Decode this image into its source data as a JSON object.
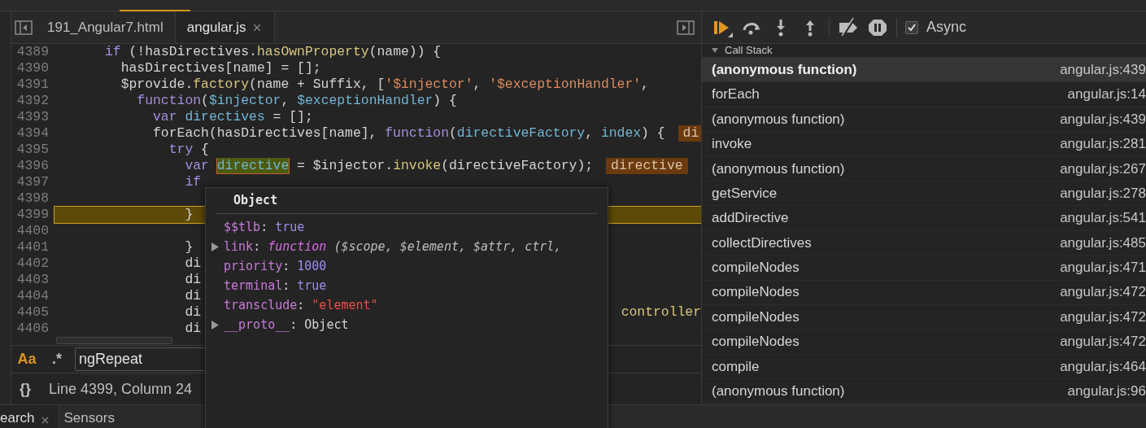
{
  "editor_tabs": [
    {
      "label": "191_Angular7.html",
      "selected": false,
      "closable": false
    },
    {
      "label": "angular.js",
      "selected": true,
      "closable": true
    }
  ],
  "code_lines": [
    {
      "number": "4389",
      "current": false,
      "tokens": [
        {
          "kind": "k",
          "text": "      if"
        },
        {
          "kind": "p",
          "text": " (!hasDirectives."
        },
        {
          "kind": "m",
          "text": "hasOwnProperty"
        },
        {
          "kind": "p",
          "text": "(name)) {"
        }
      ]
    },
    {
      "number": "4390",
      "current": false,
      "tokens": [
        {
          "kind": "p",
          "text": "        hasDirectives[name] = [];"
        }
      ]
    },
    {
      "number": "4391",
      "current": false,
      "tokens": [
        {
          "kind": "p",
          "text": "        $provide."
        },
        {
          "kind": "m",
          "text": "factory"
        },
        {
          "kind": "p",
          "text": "(name + Suffix, ["
        },
        {
          "kind": "s",
          "text": "'$injector'"
        },
        {
          "kind": "p",
          "text": ", "
        },
        {
          "kind": "s",
          "text": "'$exceptionHandler'"
        },
        {
          "kind": "p",
          "text": ","
        }
      ]
    },
    {
      "number": "4392",
      "current": false,
      "tokens": [
        {
          "kind": "k",
          "text": "          function"
        },
        {
          "kind": "p",
          "text": "("
        },
        {
          "kind": "v",
          "text": "$injector"
        },
        {
          "kind": "p",
          "text": ", "
        },
        {
          "kind": "v",
          "text": "$exceptionHandler"
        },
        {
          "kind": "p",
          "text": ") {"
        }
      ]
    },
    {
      "number": "4393",
      "current": false,
      "tokens": [
        {
          "kind": "k",
          "text": "            var "
        },
        {
          "kind": "v",
          "text": "directives"
        },
        {
          "kind": "p",
          "text": " = [];"
        }
      ]
    },
    {
      "number": "4394",
      "current": false,
      "tokens": [
        {
          "kind": "p",
          "text": "            forEach(hasDirectives[name], "
        },
        {
          "kind": "k",
          "text": "function"
        },
        {
          "kind": "p",
          "text": "("
        },
        {
          "kind": "v",
          "text": "directiveFactory"
        },
        {
          "kind": "p",
          "text": ", "
        },
        {
          "kind": "v",
          "text": "index"
        },
        {
          "kind": "p",
          "text": ") {"
        }
      ],
      "inline_value": "di"
    },
    {
      "number": "4395",
      "current": false,
      "tokens": [
        {
          "kind": "k",
          "text": "              try"
        },
        {
          "kind": "p",
          "text": " {"
        }
      ]
    },
    {
      "number": "4396",
      "current": false,
      "tokens": [
        {
          "kind": "k",
          "text": "                var "
        },
        {
          "kind": "h",
          "text": "directive"
        },
        {
          "kind": "p",
          "text": " = $injector."
        },
        {
          "kind": "m",
          "text": "invoke"
        },
        {
          "kind": "p",
          "text": "(directiveFactory);"
        }
      ],
      "inline_value": "directive"
    },
    {
      "number": "4397",
      "current": false,
      "tokens": [
        {
          "kind": "k",
          "text": "                if"
        }
      ]
    },
    {
      "number": "4398",
      "current": false
    },
    {
      "number": "4399",
      "current": true,
      "tokens": [
        {
          "kind": "p",
          "text": "                }"
        }
      ]
    },
    {
      "number": "4400",
      "current": false
    },
    {
      "number": "4401",
      "current": false,
      "tokens": [
        {
          "kind": "p",
          "text": "                }"
        }
      ]
    },
    {
      "number": "4402",
      "current": false,
      "tokens": [
        {
          "kind": "p",
          "text": "                di"
        }
      ]
    },
    {
      "number": "4403",
      "current": false,
      "tokens": [
        {
          "kind": "p",
          "text": "                di"
        }
      ]
    },
    {
      "number": "4404",
      "current": false,
      "tokens": [
        {
          "kind": "p",
          "text": "                di"
        }
      ]
    },
    {
      "number": "4405",
      "current": false,
      "tokens": [
        {
          "kind": "p",
          "text": "                di"
        }
      ],
      "tail": "controller"
    },
    {
      "number": "4406",
      "current": false,
      "tokens": [
        {
          "kind": "p",
          "text": "                di"
        }
      ]
    }
  ],
  "object_popover": {
    "title": "Object",
    "properties": [
      {
        "key": "$$tlb",
        "separator": ":",
        "expandable": false,
        "kind": "literal",
        "value": "true"
      },
      {
        "key": "link",
        "separator": ":",
        "expandable": true,
        "kind": "function",
        "value": "function ($scope, $element, $attr, ctrl,"
      },
      {
        "key": "priority",
        "separator": ":",
        "expandable": false,
        "kind": "literal",
        "value": "1000"
      },
      {
        "key": "terminal",
        "separator": ":",
        "expandable": false,
        "kind": "literal",
        "value": "true"
      },
      {
        "key": "transclude",
        "separator": ":",
        "expandable": false,
        "kind": "string",
        "value": "\"element\""
      },
      {
        "key": "__proto__",
        "separator": ":",
        "expandable": true,
        "kind": "object",
        "value": "Object"
      }
    ]
  },
  "search_bar": {
    "match_case": {
      "label": "Aa",
      "on": true
    },
    "regex": {
      "label": ".*",
      "on": false
    },
    "query": "ngRepeat"
  },
  "status_bar": {
    "format_button": "{}",
    "position": "Line 4399, Column 24"
  },
  "bottom_tabs": [
    {
      "label": "earch",
      "selected": true,
      "closable": true
    },
    {
      "label": "Sensors",
      "selected": false,
      "closable": false
    }
  ],
  "debugger_toolbar": {
    "async": {
      "label": "Async",
      "checked": true
    }
  },
  "call_stack": {
    "title": "Call Stack",
    "expanded": true,
    "frames": [
      {
        "name": "(anonymous function)",
        "location": "angular.js:439",
        "selected": true
      },
      {
        "name": "forEach",
        "location": "angular.js:14",
        "selected": false
      },
      {
        "name": "(anonymous function)",
        "location": "angular.js:439",
        "selected": false
      },
      {
        "name": "invoke",
        "location": "angular.js:281",
        "selected": false
      },
      {
        "name": "(anonymous function)",
        "location": "angular.js:267",
        "selected": false
      },
      {
        "name": "getService",
        "location": "angular.js:278",
        "selected": false
      },
      {
        "name": "addDirective",
        "location": "angular.js:541",
        "selected": false
      },
      {
        "name": "collectDirectives",
        "location": "angular.js:485",
        "selected": false
      },
      {
        "name": "compileNodes",
        "location": "angular.js:471",
        "selected": false
      },
      {
        "name": "compileNodes",
        "location": "angular.js:472",
        "selected": false
      },
      {
        "name": "compileNodes",
        "location": "angular.js:472",
        "selected": false
      },
      {
        "name": "compileNodes",
        "location": "angular.js:472",
        "selected": false
      },
      {
        "name": "compile",
        "location": "angular.js:464",
        "selected": false
      },
      {
        "name": "(anonymous function)",
        "location": "angular.js:96",
        "selected": false
      }
    ]
  }
}
